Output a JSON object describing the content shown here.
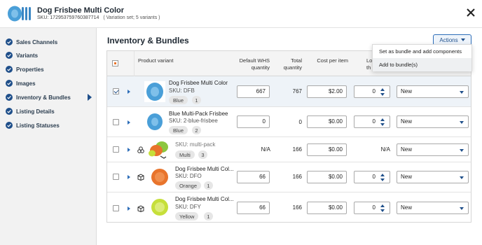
{
  "header": {
    "title": "Dog Frisbee Multi Color",
    "sku_line": "SKU: 172953759760387714",
    "variation_note": "( Variation set; 5 variants )"
  },
  "sidebar": {
    "items": [
      {
        "label": "Sales Channels"
      },
      {
        "label": "Variants"
      },
      {
        "label": "Properties"
      },
      {
        "label": "Images"
      },
      {
        "label": "Inventory & Bundles",
        "active": true
      },
      {
        "label": "Listing Details"
      },
      {
        "label": "Listing Statuses"
      }
    ]
  },
  "main": {
    "title": "Inventory & Bundles",
    "actions_label": "Actions",
    "actions_menu": [
      {
        "label": "Set as bundle and add components"
      },
      {
        "label": "Add to bundle(s)"
      }
    ]
  },
  "table": {
    "headers": {
      "product_variant": "Product variant",
      "default_whs_1": "Default WHS",
      "default_whs_2": "quantity",
      "total_1": "Total",
      "total_2": "quantity",
      "cost": "Cost per item",
      "low_1": "Lo",
      "low_2": "th"
    },
    "rows": [
      {
        "name": "Dog Frisbee Multi Color",
        "sku": "SKU: DFB",
        "color": "Blue",
        "count": "1",
        "whs": "667",
        "total": "767",
        "cost": "$2.00",
        "low": "0",
        "status": "New",
        "checked": true
      },
      {
        "name": "Blue Multi-Pack Frisbee",
        "sku": "SKU: 2-blue-frisbee",
        "color": "Blue",
        "count": "2",
        "whs": "0",
        "total": "0",
        "cost": "$0.00",
        "low": "0",
        "status": "New",
        "checked": false
      },
      {
        "name": "",
        "sku": "SKU: multi-pack",
        "color": "Multi",
        "count": "3",
        "whs": "N/A",
        "total": "166",
        "cost": "$0.00",
        "low": "N/A",
        "status": "New",
        "checked": false
      },
      {
        "name": "Dog Frisbee Multi Col...",
        "sku": "SKU: DFO",
        "color": "Orange",
        "count": "1",
        "whs": "66",
        "total": "166",
        "cost": "$0.00",
        "low": "0",
        "status": "New",
        "checked": false
      },
      {
        "name": "Dog Frisbee Multi Col...",
        "sku": "SKU: DFY",
        "color": "Yellow",
        "count": "1",
        "whs": "66",
        "total": "166",
        "cost": "$0.00",
        "low": "0",
        "status": "New",
        "checked": false
      }
    ]
  },
  "colors": {
    "accent": "#2d6db8",
    "frisbee_blue": "#4a9fd8",
    "frisbee_orange": "#e8742c",
    "frisbee_yellow": "#c6df3a",
    "frisbee_green": "#8cc63f"
  },
  "icons": {
    "close": "close-icon",
    "check_circle": "check-circle-icon",
    "bundle": "bundle-icon",
    "box": "box-icon"
  }
}
